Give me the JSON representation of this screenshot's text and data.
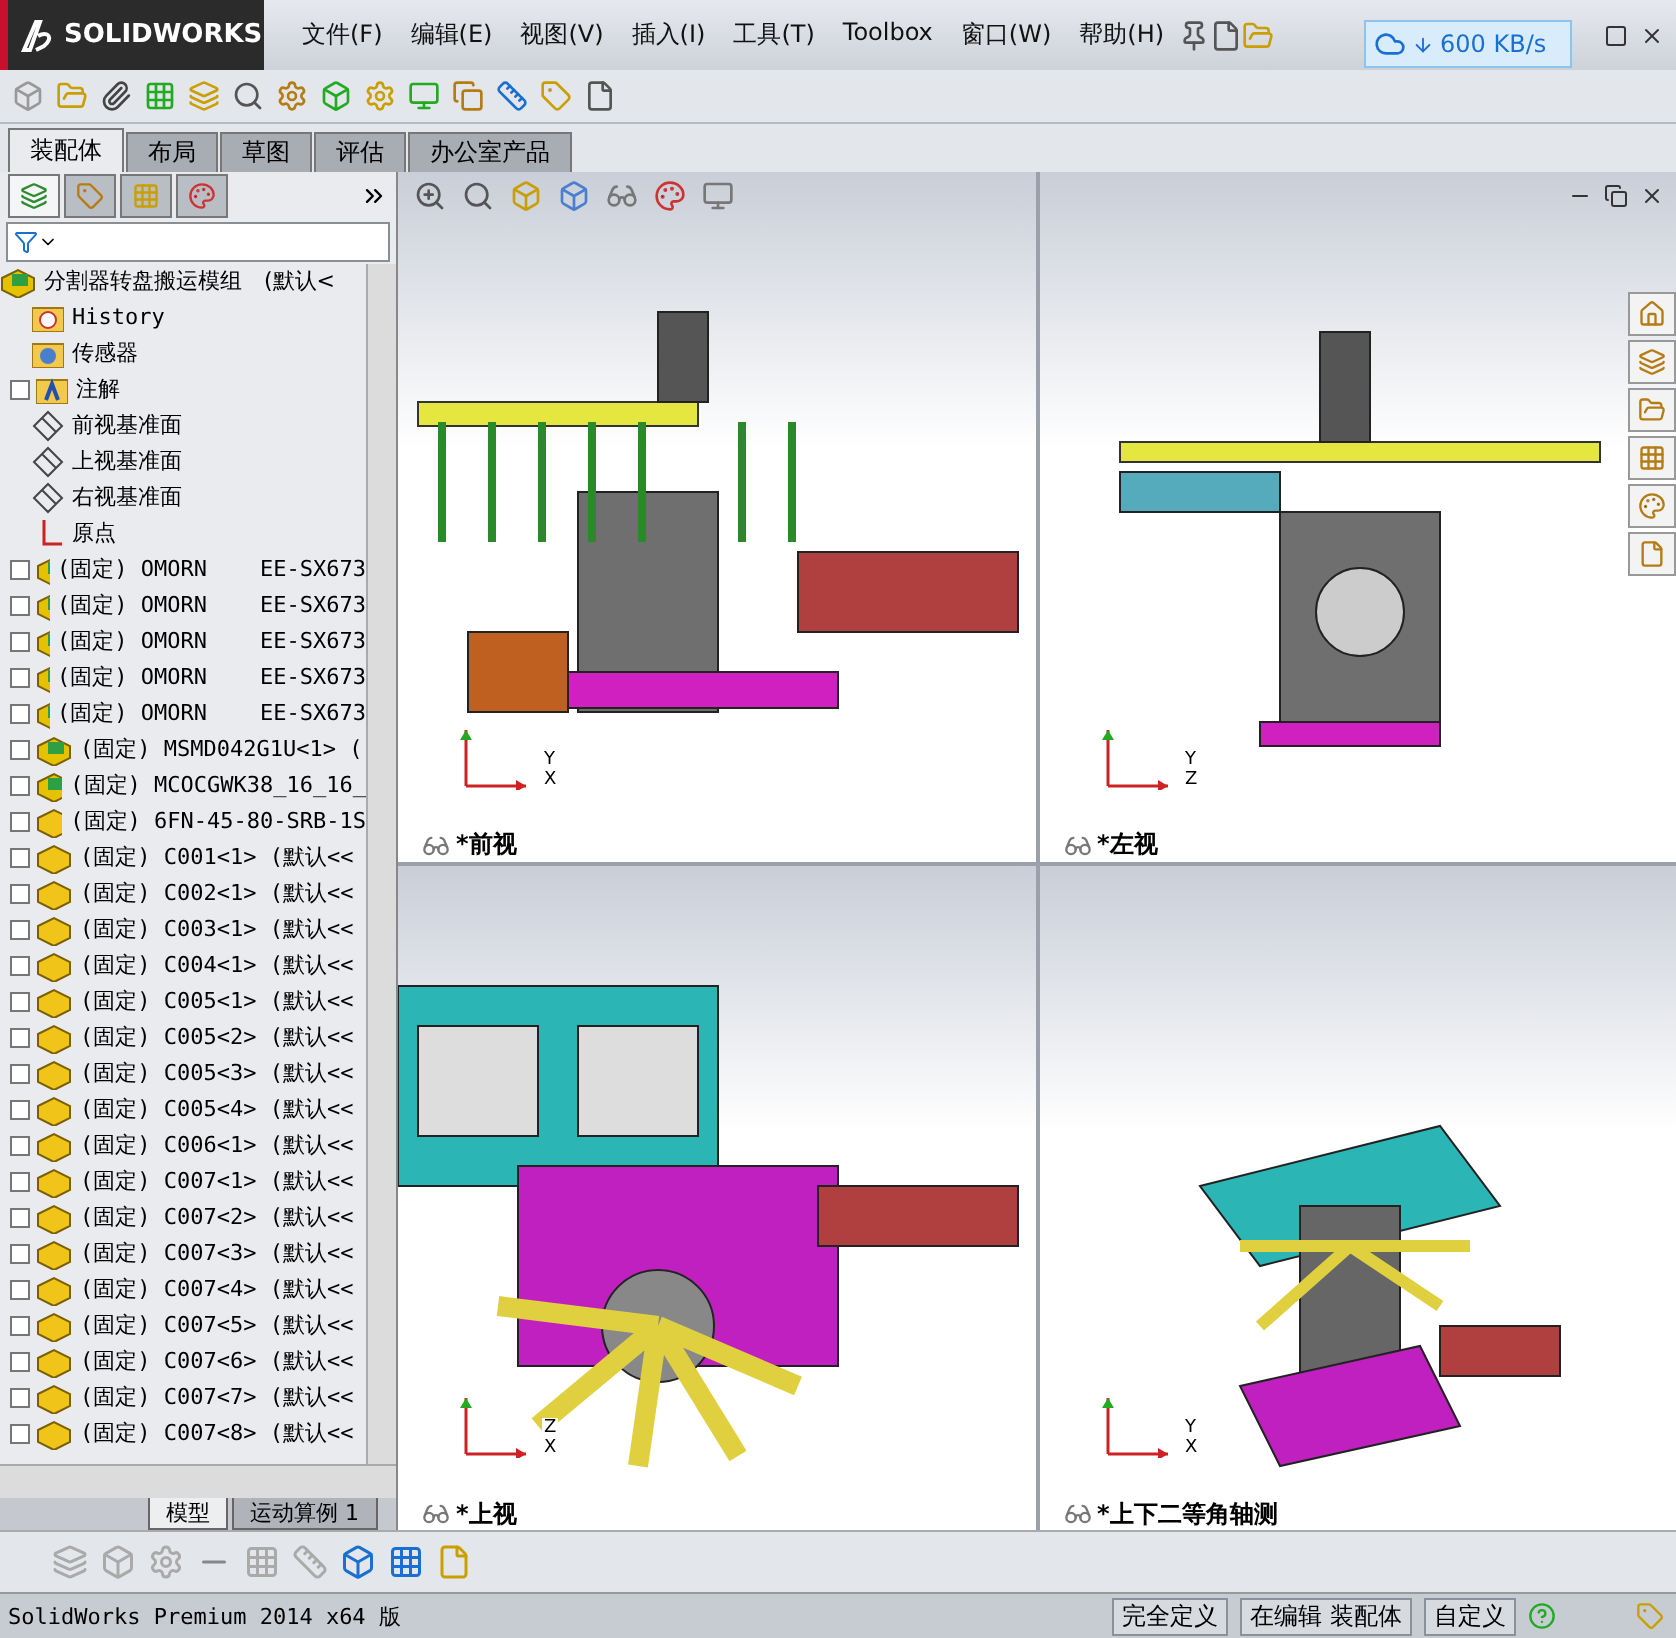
{
  "app": {
    "logo": "SOLIDWORKS",
    "net_speed": "600 KB/s"
  },
  "menu": [
    "文件(F)",
    "编辑(E)",
    "视图(V)",
    "插入(I)",
    "工具(T)",
    "Toolbox",
    "窗口(W)",
    "帮助(H)"
  ],
  "command_tabs": [
    {
      "label": "装配体",
      "selected": true
    },
    {
      "label": "布局",
      "selected": false
    },
    {
      "label": "草图",
      "selected": false
    },
    {
      "label": "评估",
      "selected": false
    },
    {
      "label": "办公室产品",
      "selected": false
    }
  ],
  "panel_tabs": [
    {
      "kind": "tree",
      "selected": true
    },
    {
      "kind": "property",
      "selected": false
    },
    {
      "kind": "config",
      "selected": false
    },
    {
      "kind": "appearance",
      "selected": false
    }
  ],
  "tree": {
    "label": "分割器转盘搬运模组　(默认<",
    "children": [
      {
        "kind": "history",
        "label": "History",
        "expandable": false
      },
      {
        "kind": "sensor",
        "label": "传感器",
        "expandable": false
      },
      {
        "kind": "annotation",
        "label": "注解",
        "expandable": true
      },
      {
        "kind": "plane",
        "label": "前视基准面",
        "expandable": false
      },
      {
        "kind": "plane",
        "label": "上视基准面",
        "expandable": false
      },
      {
        "kind": "plane",
        "label": "右视基准面",
        "expandable": false
      },
      {
        "kind": "origin",
        "label": "原点",
        "expandable": false
      },
      {
        "kind": "assembly",
        "label": "(固定) OMORN    EE-SX673",
        "expandable": true
      },
      {
        "kind": "assembly",
        "label": "(固定) OMORN    EE-SX673",
        "expandable": true
      },
      {
        "kind": "assembly",
        "label": "(固定) OMORN    EE-SX673",
        "expandable": true
      },
      {
        "kind": "assembly",
        "label": "(固定) OMORN    EE-SX673",
        "expandable": true
      },
      {
        "kind": "assembly",
        "label": "(固定) OMORN    EE-SX673",
        "expandable": true
      },
      {
        "kind": "assembly",
        "label": "(固定) MSMD042G1U<1> (",
        "expandable": true
      },
      {
        "kind": "assembly",
        "label": "(固定) MCOCGWK38_16_16_",
        "expandable": true
      },
      {
        "kind": "part",
        "label": "(固定) 6FN-45-80-SRB-1S",
        "expandable": true
      },
      {
        "kind": "part",
        "label": "(固定) C001<1> (默认<<",
        "expandable": true
      },
      {
        "kind": "part",
        "label": "(固定) C002<1> (默认<<",
        "expandable": true
      },
      {
        "kind": "part",
        "label": "(固定) C003<1> (默认<<",
        "expandable": true
      },
      {
        "kind": "part",
        "label": "(固定) C004<1> (默认<<",
        "expandable": true
      },
      {
        "kind": "part",
        "label": "(固定) C005<1> (默认<<",
        "expandable": true
      },
      {
        "kind": "part",
        "label": "(固定) C005<2> (默认<<",
        "expandable": true
      },
      {
        "kind": "part",
        "label": "(固定) C005<3> (默认<<",
        "expandable": true
      },
      {
        "kind": "part",
        "label": "(固定) C005<4> (默认<<",
        "expandable": true
      },
      {
        "kind": "part",
        "label": "(固定) C006<1> (默认<<",
        "expandable": true
      },
      {
        "kind": "part",
        "label": "(固定) C007<1> (默认<<",
        "expandable": true
      },
      {
        "kind": "part",
        "label": "(固定) C007<2> (默认<<",
        "expandable": true
      },
      {
        "kind": "part",
        "label": "(固定) C007<3> (默认<<",
        "expandable": true
      },
      {
        "kind": "part",
        "label": "(固定) C007<4> (默认<<",
        "expandable": true
      },
      {
        "kind": "part",
        "label": "(固定) C007<5> (默认<<",
        "expandable": true
      },
      {
        "kind": "part",
        "label": "(固定) C007<6> (默认<<",
        "expandable": true
      },
      {
        "kind": "part",
        "label": "(固定) C007<7> (默认<<",
        "expandable": true
      },
      {
        "kind": "part",
        "label": "(固定) C007<8> (默认<<",
        "expandable": true
      }
    ]
  },
  "viewports": [
    {
      "label": "*前视",
      "kind": "front",
      "axes": [
        "Y",
        "X"
      ]
    },
    {
      "label": "*左视",
      "kind": "side",
      "axes": [
        "Y",
        "Z"
      ]
    },
    {
      "label": "*上视",
      "kind": "top",
      "axes": [
        "Z",
        "X"
      ]
    },
    {
      "label": "*上下二等角轴测",
      "kind": "iso",
      "axes": [
        "Y",
        "X"
      ]
    }
  ],
  "bottom_tabs": [
    {
      "label": "模型",
      "selected": true
    },
    {
      "label": "运动算例 1",
      "selected": false
    }
  ],
  "status_bar": {
    "product": "SolidWorks Premium 2014 x64 版",
    "fields": [
      "完全定义",
      "在编辑 装配体",
      "自定义"
    ]
  }
}
